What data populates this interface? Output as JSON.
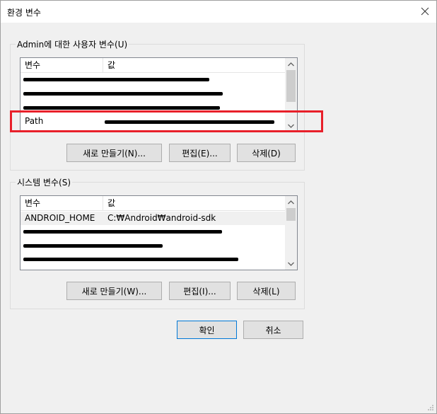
{
  "window": {
    "title": "환경 변수",
    "close_icon": "close-icon"
  },
  "user_vars": {
    "label": "Admin에 대한 사용자 변수(U)",
    "col_var": "변수",
    "col_val": "값",
    "rows": [
      {
        "var": "",
        "val": ""
      },
      {
        "var": "",
        "val": ""
      },
      {
        "var": "",
        "val": ""
      },
      {
        "var": "Path",
        "val": ""
      }
    ],
    "new_btn": "새로 만들기(N)...",
    "edit_btn": "편집(E)...",
    "delete_btn": "삭제(D)"
  },
  "system_vars": {
    "label": "시스템 변수(S)",
    "col_var": "변수",
    "col_val": "값",
    "rows": [
      {
        "var": "ANDROID_HOME",
        "val": "C:₩Android₩android-sdk"
      },
      {
        "var": "",
        "val": ""
      },
      {
        "var": "",
        "val": ""
      },
      {
        "var": "",
        "val": ""
      }
    ],
    "new_btn": "새로 만들기(W)...",
    "edit_btn": "편집(I)...",
    "delete_btn": "삭제(L)"
  },
  "footer": {
    "ok_btn": "확인",
    "cancel_btn": "취소"
  },
  "colors": {
    "highlight": "#e8202a",
    "redaction": "#000000"
  }
}
